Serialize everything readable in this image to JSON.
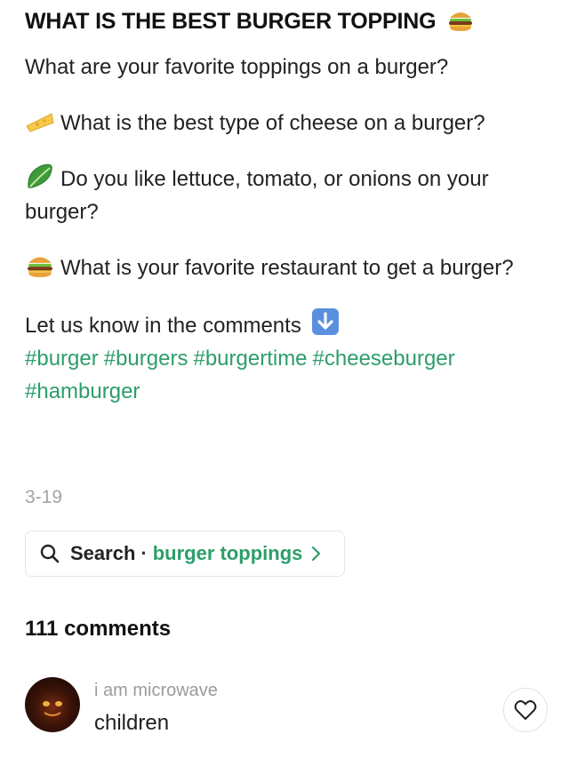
{
  "post": {
    "title": "WHAT IS THE BEST BURGER TOPPING",
    "title_emoji_icon": "burger-icon",
    "intro": "What are your favorite toppings on a burger?",
    "questions": [
      {
        "icon": "cheese-icon",
        "text": "What is the best type of cheese on a burger?"
      },
      {
        "icon": "lettuce-icon",
        "text": "Do you like lettuce, tomato, or onions on your burger?"
      },
      {
        "icon": "burger-icon",
        "text": "What is your favorite restaurant to get a burger?"
      }
    ],
    "cta": "Let us know in the comments",
    "cta_icon": "down-arrow-icon",
    "hashtags": [
      "#burger",
      "#burgers",
      "#burgertime",
      "#cheeseburger",
      "#hamburger"
    ],
    "date": "3-19"
  },
  "search_chip": {
    "label": "Search",
    "separator": "·",
    "query": "burger toppings"
  },
  "comments": {
    "count_label": "111 comments",
    "items": [
      {
        "author": "i am microwave",
        "text": "children"
      }
    ]
  },
  "colors": {
    "accent": "#2c9e6a",
    "muted": "#a3a3a3",
    "text": "#1f1f1f"
  }
}
